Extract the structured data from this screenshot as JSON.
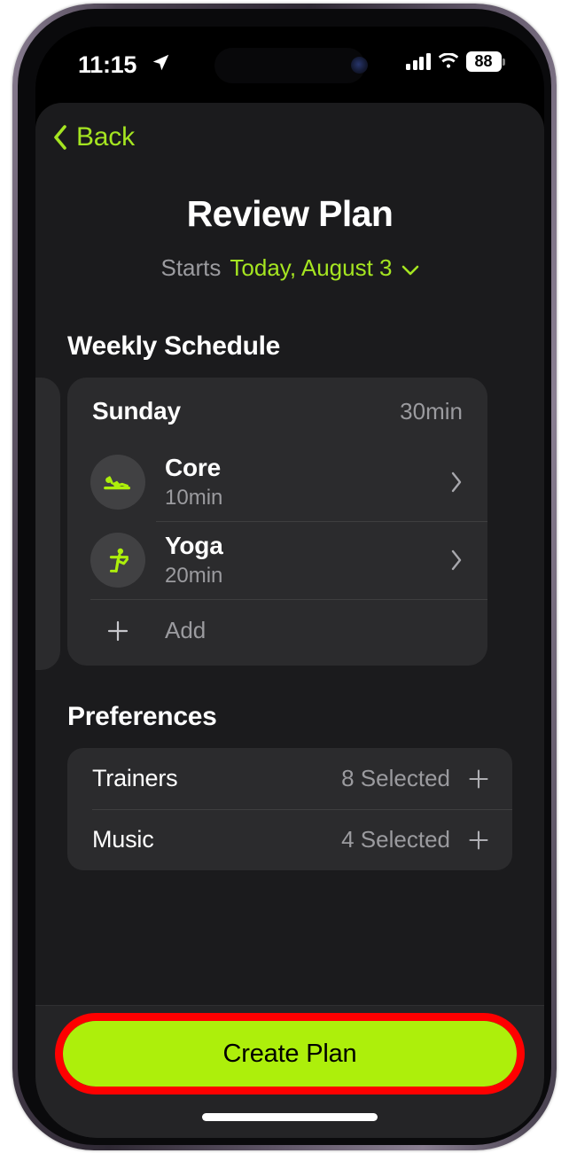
{
  "status_bar": {
    "time": "11:15",
    "location_icon": "location-arrow-icon",
    "signal_icon": "cellular-signal-icon",
    "wifi_icon": "wifi-icon",
    "battery_level": "88"
  },
  "nav": {
    "back_label": "Back",
    "back_icon": "chevron-left-icon",
    "accent_color": "#a5e521"
  },
  "header": {
    "title": "Review Plan",
    "starts_label": "Starts",
    "starts_date": "Today, August 3",
    "starts_chevron_icon": "chevron-down-icon"
  },
  "weekly_schedule": {
    "heading": "Weekly Schedule",
    "prev_day_chevron_icon": "chevron-right-icon",
    "day": {
      "name": "Sunday",
      "total_duration": "30min",
      "workouts": [
        {
          "name": "Core",
          "duration": "10min",
          "icon": "core-workout-icon",
          "chevron_icon": "chevron-right-icon"
        },
        {
          "name": "Yoga",
          "duration": "20min",
          "icon": "yoga-workout-icon",
          "chevron_icon": "chevron-right-icon"
        }
      ],
      "add_label": "Add",
      "add_icon": "plus-icon"
    }
  },
  "preferences": {
    "heading": "Preferences",
    "rows": [
      {
        "label": "Trainers",
        "value": "8 Selected",
        "icon": "plus-icon"
      },
      {
        "label": "Music",
        "value": "4 Selected",
        "icon": "plus-icon"
      }
    ]
  },
  "bottom_bar": {
    "create_plan_label": "Create Plan",
    "button_color": "#adef0b",
    "highlight_color": "#fe0000"
  }
}
